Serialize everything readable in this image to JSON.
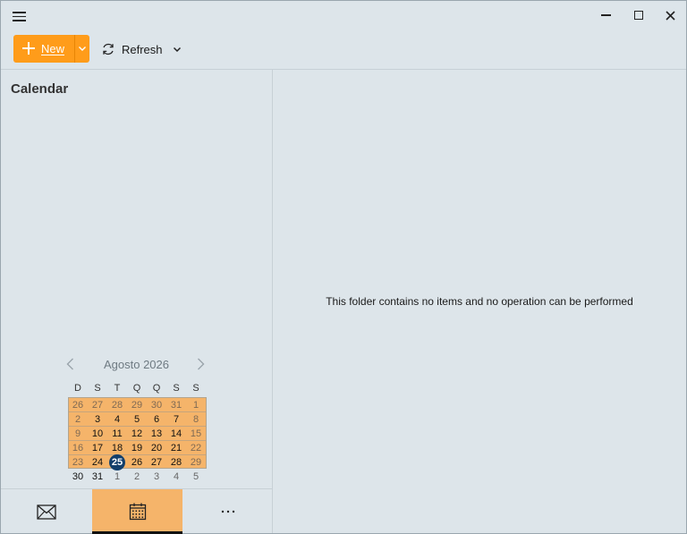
{
  "toolbar": {
    "new_label": "New",
    "refresh_label": "Refresh"
  },
  "sidebar": {
    "title": "Calendar"
  },
  "mini_calendar": {
    "month_label": "Agosto 2026",
    "weekday_headers": [
      "D",
      "S",
      "T",
      "Q",
      "Q",
      "S",
      "S"
    ],
    "weeks": [
      [
        "26",
        "27",
        "28",
        "29",
        "30",
        "31",
        "1"
      ],
      [
        "2",
        "3",
        "4",
        "5",
        "6",
        "7",
        "8"
      ],
      [
        "9",
        "10",
        "11",
        "12",
        "13",
        "14",
        "15"
      ],
      [
        "16",
        "17",
        "18",
        "19",
        "20",
        "21",
        "22"
      ],
      [
        "23",
        "24",
        "25",
        "26",
        "27",
        "28",
        "29"
      ],
      [
        "30",
        "31",
        "1",
        "2",
        "3",
        "4",
        "5"
      ]
    ],
    "today": "25"
  },
  "main": {
    "empty_message": "This folder contains no items and no operation can be performed"
  },
  "colors": {
    "accent": "#ff9c1a",
    "selection": "#f5b46a",
    "today": "#133f6b",
    "background": "#dde5ea"
  }
}
